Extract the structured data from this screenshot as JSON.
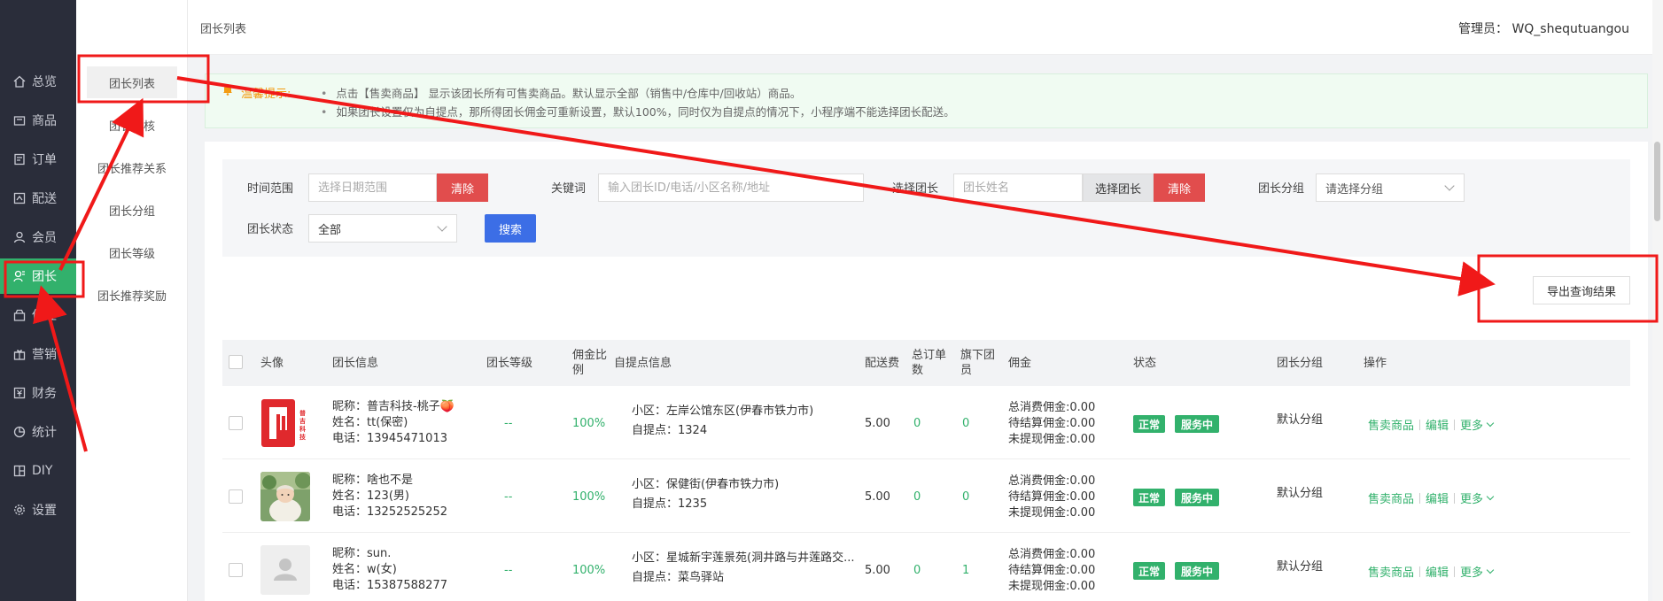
{
  "header": {
    "title": "团长列表",
    "admin": "管理员： WQ_shequtuangou"
  },
  "sidebar": {
    "items": [
      {
        "label": "总览",
        "icon": "home-icon"
      },
      {
        "label": "商品",
        "icon": "goods-icon"
      },
      {
        "label": "订单",
        "icon": "order-icon"
      },
      {
        "label": "配送",
        "icon": "delivery-icon"
      },
      {
        "label": "会员",
        "icon": "member-icon"
      },
      {
        "label": "团长",
        "icon": "leader-icon",
        "active": true
      },
      {
        "label": "供应",
        "icon": "supply-icon"
      },
      {
        "label": "营销",
        "icon": "marketing-icon"
      },
      {
        "label": "财务",
        "icon": "finance-icon"
      },
      {
        "label": "统计",
        "icon": "stats-icon"
      },
      {
        "label": "DIY",
        "icon": "diy-icon"
      },
      {
        "label": "设置",
        "icon": "settings-icon"
      }
    ]
  },
  "subnav": {
    "items": [
      {
        "label": "团长列表",
        "active": true
      },
      {
        "label": "团长审核"
      },
      {
        "label": "团长推荐关系"
      },
      {
        "label": "团长分组"
      },
      {
        "label": "团长等级"
      },
      {
        "label": "团长推荐奖励"
      }
    ]
  },
  "tips": {
    "title": "温馨提示:",
    "lines": [
      "点击【售卖商品】 显示该团长所有可售卖商品。默认显示全部（销售中/仓库中/回收站）商品。",
      "如果团长设置仅为自提点，那所得团长佣金可重新设置，默认100%，同时仅为自提点的情况下，小程序端不能选择团长配送。"
    ]
  },
  "filter": {
    "time_label": "时间范围",
    "time_placeholder": "选择日期范围",
    "clear": "清除",
    "keyword_label": "关键词",
    "keyword_placeholder": "输入团长ID/电话/小区名称/地址",
    "leader_label": "选择团长",
    "leader_placeholder": "团长姓名",
    "select_leader": "选择团长",
    "group_label": "团长分组",
    "group_placeholder": "请选择分组",
    "status_label": "团长状态",
    "status_value": "全部",
    "search": "搜索"
  },
  "export_label": "导出查询结果",
  "table": {
    "headers": [
      "头像",
      "团长信息",
      "团长等级",
      "佣金比例",
      "自提点信息",
      "配送费",
      "总订单数",
      "旗下团员",
      "佣金",
      "状态",
      "团长分组",
      "操作"
    ],
    "rows": [
      {
        "nickname": "昵称：普吉科技-桃子🍑",
        "name": "姓名：tt(保密)",
        "phone": "电话：13945471013",
        "level": "--",
        "ratio": "100%",
        "community": "小区：左岸公馆东区(伊春市铁力市)",
        "pickup": "自提点：1324",
        "fee": "5.00",
        "orders": "0",
        "members": "0",
        "c1": "总消费佣金:0.00",
        "c2": "待结算佣金:0.00",
        "c3": "未提现佣金:0.00",
        "status1": "正常",
        "status2": "服务中",
        "group": "默认分组",
        "avatar": "logo"
      },
      {
        "nickname": "昵称：啥也不是",
        "name": "姓名：123(男)",
        "phone": "电话：13252525252",
        "level": "--",
        "ratio": "100%",
        "community": "小区：保健街(伊春市铁力市)",
        "pickup": "自提点：1235",
        "fee": "5.00",
        "orders": "0",
        "members": "0",
        "c1": "总消费佣金:0.00",
        "c2": "待结算佣金:0.00",
        "c3": "未提现佣金:0.00",
        "status1": "正常",
        "status2": "服务中",
        "group": "默认分组",
        "avatar": "photo"
      },
      {
        "nickname": "昵称：sun.",
        "name": "姓名：w(女)",
        "phone": "电话：15387588277",
        "level": "--",
        "ratio": "100%",
        "community": "小区：星城新宇莲景苑(洞井路与井莲路交...",
        "pickup": "自提点：菜鸟驿站",
        "fee": "5.00",
        "orders": "0",
        "members": "1",
        "c1": "总消费佣金:0.00",
        "c2": "待结算佣金:0.00",
        "c3": "未提现佣金:0.00",
        "status1": "正常",
        "status2": "服务中",
        "group": "默认分组",
        "avatar": "default"
      }
    ],
    "ops": {
      "sell": "售卖商品",
      "edit": "编辑",
      "more": "更多"
    }
  },
  "logo_text": "普吉科技",
  "colors": {
    "accent": "#32b16c",
    "danger": "#e14d4d",
    "primary": "#3c6ee6",
    "annotation": "#f01919"
  }
}
